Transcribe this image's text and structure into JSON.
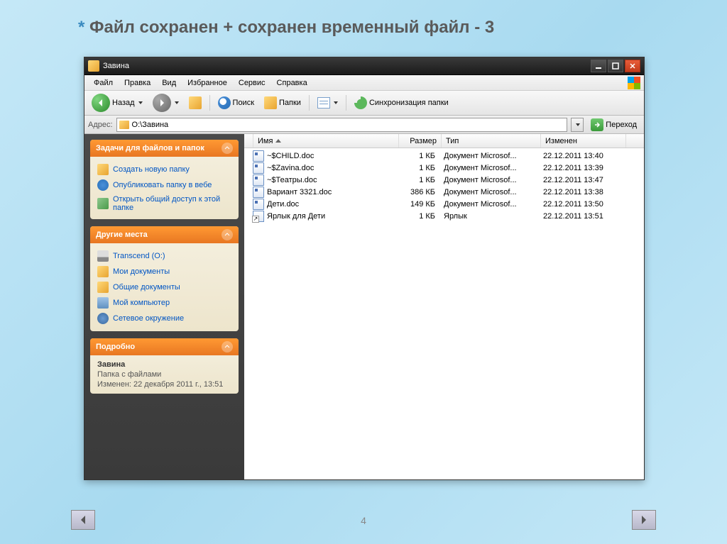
{
  "slide": {
    "title": "Файл сохранен + сохранен временный файл - 3",
    "page_number": "4"
  },
  "window": {
    "title": "Завина"
  },
  "menubar": {
    "file": "Файл",
    "edit": "Правка",
    "view": "Вид",
    "favorites": "Избранное",
    "tools": "Сервис",
    "help": "Справка"
  },
  "toolbar": {
    "back": "Назад",
    "search": "Поиск",
    "folders": "Папки",
    "sync": "Синхронизация папки"
  },
  "address": {
    "label": "Адрес:",
    "path": "O:\\Завина",
    "go": "Переход"
  },
  "sidebar": {
    "tasks": {
      "header": "Задачи для файлов и папок",
      "items": [
        "Создать новую папку",
        "Опубликовать папку в вебе",
        "Открыть общий доступ к этой папке"
      ]
    },
    "places": {
      "header": "Другие места",
      "items": [
        "Transcend (O:)",
        "Мои документы",
        "Общие документы",
        "Мой компьютер",
        "Сетевое окружение"
      ]
    },
    "details": {
      "header": "Подробно",
      "name": "Завина",
      "type": "Папка с файлами",
      "modified": "Изменен: 22 декабря 2011 г., 13:51"
    }
  },
  "columns": {
    "name": "Имя",
    "size": "Размер",
    "type": "Тип",
    "modified": "Изменен"
  },
  "files": [
    {
      "name": "~$CHILD.doc",
      "size": "1 КБ",
      "type": "Документ Microsof...",
      "modified": "22.12.2011 13:40",
      "icon": "doc"
    },
    {
      "name": "~$Zavina.doc",
      "size": "1 КБ",
      "type": "Документ Microsof...",
      "modified": "22.12.2011 13:39",
      "icon": "doc"
    },
    {
      "name": "~$Театры.doc",
      "size": "1 КБ",
      "type": "Документ Microsof...",
      "modified": "22.12.2011 13:47",
      "icon": "doc"
    },
    {
      "name": "Вариант 3321.doc",
      "size": "386 КБ",
      "type": "Документ Microsof...",
      "modified": "22.12.2011 13:38",
      "icon": "doc"
    },
    {
      "name": "Дети.doc",
      "size": "149 КБ",
      "type": "Документ Microsof...",
      "modified": "22.12.2011 13:50",
      "icon": "doc"
    },
    {
      "name": "Ярлык для Дети",
      "size": "1 КБ",
      "type": "Ярлык",
      "modified": "22.12.2011 13:51",
      "icon": "shortcut"
    }
  ]
}
